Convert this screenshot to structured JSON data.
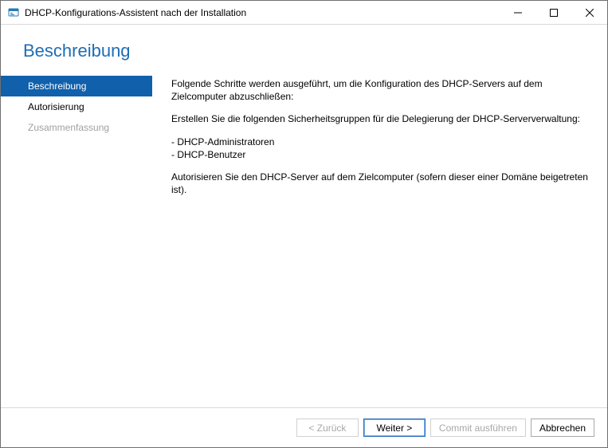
{
  "window": {
    "title": "DHCP-Konfigurations-Assistent nach der Installation"
  },
  "page": {
    "heading": "Beschreibung"
  },
  "sidebar": {
    "items": [
      {
        "label": "Beschreibung"
      },
      {
        "label": "Autorisierung"
      },
      {
        "label": "Zusammenfassung"
      }
    ]
  },
  "content": {
    "intro": "Folgende Schritte werden ausgeführt, um die Konfiguration des DHCP-Servers auf dem Zielcomputer abzuschließen:",
    "groups_intro": "Erstellen Sie die folgenden Sicherheitsgruppen für die Delegierung der DHCP-Serververwaltung:",
    "groups": [
      "- DHCP-Administratoren",
      "- DHCP-Benutzer"
    ],
    "authorize": "Autorisieren Sie den DHCP-Server auf dem Zielcomputer (sofern dieser einer Domäne beigetreten ist)."
  },
  "buttons": {
    "back": "< Zurück",
    "next": "Weiter >",
    "commit": "Commit ausführen",
    "cancel": "Abbrechen"
  }
}
